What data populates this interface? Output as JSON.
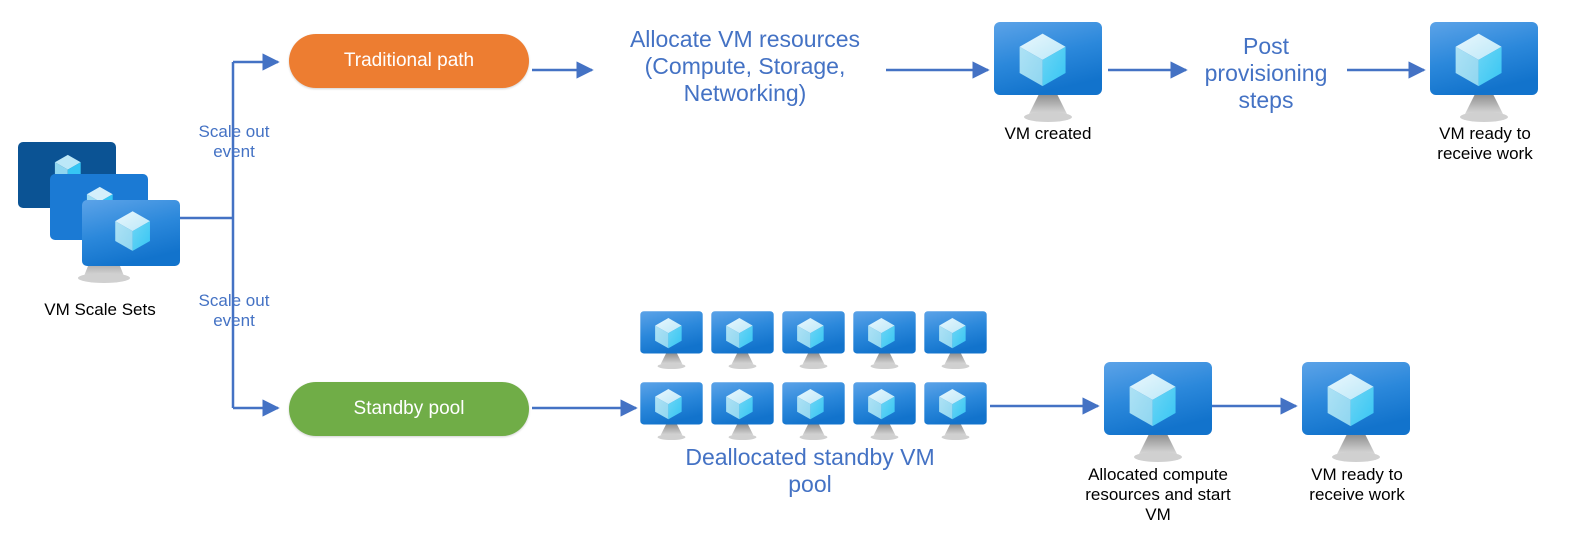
{
  "diagram": {
    "title": "VM Scale Sets standby pool flow",
    "accent_blue": "#4472C4",
    "orange": "#ED7D31",
    "green": "#70AD47",
    "vm_icon_name": "azure-virtual-machine-icon"
  },
  "source": {
    "label": "VM Scale Sets"
  },
  "branches": {
    "top_event_label": "Scale out\nevent",
    "bottom_event_label": "Scale out\nevent"
  },
  "top_path": {
    "pill_label": "Traditional path",
    "step_allocate": "Allocate VM resources\n(Compute, Storage,\nNetworking)",
    "vm_created_label": "VM created",
    "step_post_provisioning": "Post\nprovisioning\nsteps",
    "vm_ready_label": "VM ready to\nreceive work"
  },
  "bottom_path": {
    "pill_label": "Standby pool",
    "pool_label": "Deallocated standby VM\npool",
    "pool_count": 10,
    "pool_rows": 2,
    "pool_cols": 5,
    "allocated_label": "Allocated compute\nresources and start\nVM",
    "vm_ready_label": "VM ready to\nreceive work"
  }
}
